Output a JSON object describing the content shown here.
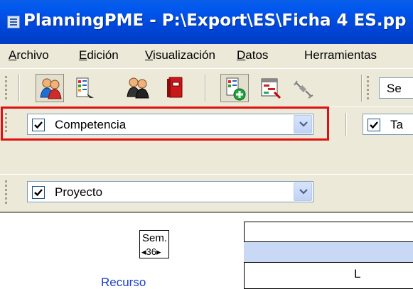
{
  "window": {
    "title": "PlanningPME - P:\\Export\\ES\\Ficha 4 ES.pp"
  },
  "menu": [
    {
      "accel": "A",
      "rest": "rchivo"
    },
    {
      "accel": "E",
      "rest": "dición"
    },
    {
      "accel": "V",
      "rest": "isualización"
    },
    {
      "accel": "D",
      "rest": "atos"
    },
    {
      "accel": "",
      "rest": "Herramientas"
    }
  ],
  "toolbar": {
    "icons": [
      "resources-icon",
      "task-report-icon",
      "team-icon",
      "binder-icon",
      "add-task-icon",
      "planning-grid-icon",
      "link-icon"
    ],
    "search_partial": "Se"
  },
  "filters": {
    "competencia": {
      "label": "Competencia",
      "checked": true
    },
    "tarea_partial": {
      "label": "Ta",
      "checked": true
    },
    "proyecto": {
      "label": "Proyecto",
      "checked": true
    }
  },
  "grid": {
    "sem_label": "Sem.",
    "sem_nav": "◂36▸",
    "recurso_label": "Recurso",
    "day_label": "L"
  }
}
